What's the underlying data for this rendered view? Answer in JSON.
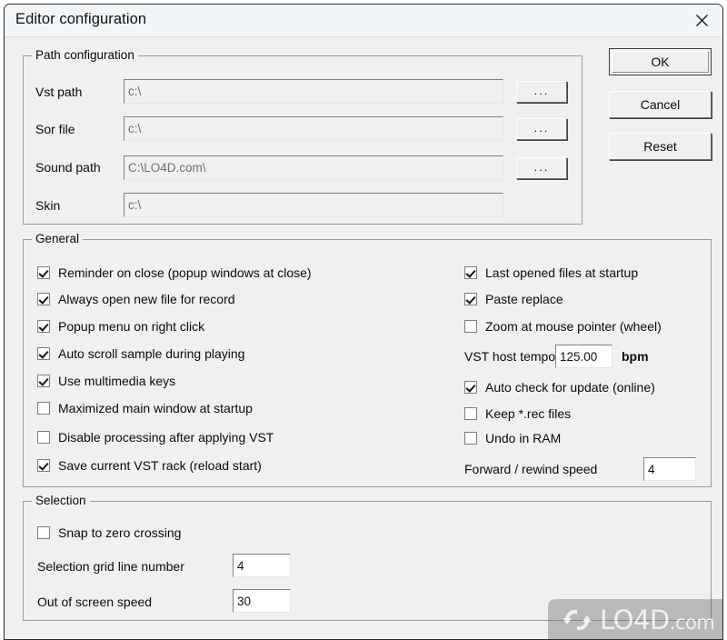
{
  "window": {
    "title": "Editor configuration",
    "close_icon": "close-icon",
    "bg_color": "#f0f0f0",
    "titlebar_color": "#f2f5f8"
  },
  "path_configuration": {
    "legend": "Path configuration",
    "browse_label": "...",
    "rows": [
      {
        "label": "Vst path",
        "value": "c:\\",
        "enabled": false
      },
      {
        "label": "Sor file",
        "value": "c:\\",
        "enabled": false
      },
      {
        "label": "Sound path",
        "value": "C:\\LO4D.com\\",
        "enabled": false
      },
      {
        "label": "Skin",
        "value": "c:\\",
        "enabled": false
      }
    ]
  },
  "dialog_buttons": {
    "ok": "OK",
    "cancel": "Cancel",
    "reset": "Reset"
  },
  "general": {
    "legend": "General",
    "left_checkboxes": [
      {
        "label": "Reminder on close (popup windows at close)",
        "checked": true
      },
      {
        "label": "Always open new file for record",
        "checked": true
      },
      {
        "label": "Popup menu on right click",
        "checked": true
      },
      {
        "label": "Auto scroll sample during playing",
        "checked": true
      },
      {
        "label": "Use multimedia keys",
        "checked": true
      },
      {
        "label": "Maximized main window at startup",
        "checked": false
      },
      {
        "label": "Disable processing after applying VST",
        "checked": false
      },
      {
        "label": "Save current VST rack (reload start)",
        "checked": true
      }
    ],
    "right_checkboxes_top": [
      {
        "label": "Last opened files at startup",
        "checked": true
      },
      {
        "label": "Paste replace",
        "checked": true
      },
      {
        "label": "Zoom at mouse pointer (wheel)",
        "checked": false
      }
    ],
    "vst_host_tempo": {
      "label": "VST host tempo",
      "value": "125.00",
      "unit": "bpm"
    },
    "right_checkboxes_bottom": [
      {
        "label": "Auto check for update (online)",
        "checked": true
      },
      {
        "label": "Keep *.rec files",
        "checked": false
      },
      {
        "label": "Undo in RAM",
        "checked": false
      }
    ],
    "forward_rewind": {
      "label": "Forward / rewind speed",
      "value": "4"
    }
  },
  "selection": {
    "legend": "Selection",
    "snap_checkbox": {
      "label": "Snap to zero crossing",
      "checked": false
    },
    "fields": [
      {
        "label": "Selection grid line number",
        "value": "4"
      },
      {
        "label": "Out of screen speed",
        "value": "30"
      }
    ]
  },
  "watermark": {
    "name": "LO4D",
    "suffix": ".com",
    "icon": "refresh-arrows-icon"
  }
}
